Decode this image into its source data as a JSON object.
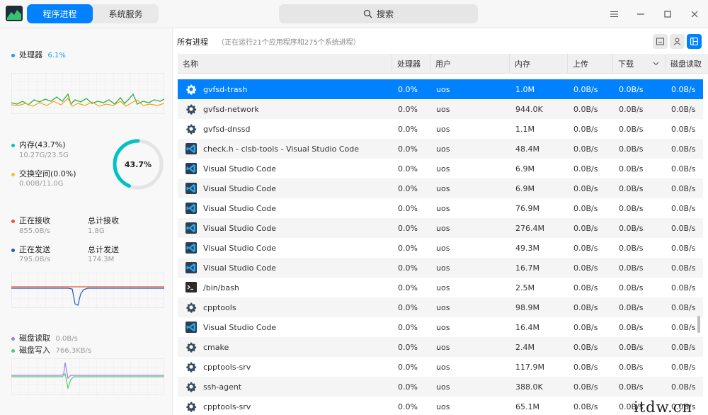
{
  "titlebar": {
    "tabs": [
      {
        "label": "程序进程",
        "active": true
      },
      {
        "label": "系统服务",
        "active": false
      }
    ],
    "search_label": "搜索"
  },
  "left": {
    "cpu": {
      "label": "处理器",
      "value": "6.1%",
      "color": "#1a9fe8"
    },
    "memory": {
      "label": "内存(43.7%)",
      "detail": "10.27G/23.5G",
      "color": "#00c3c3",
      "gauge_text": "43.7%",
      "gauge_fraction": 0.437
    },
    "swap": {
      "label": "交换空间(0.0%)",
      "detail": "0.00B/11.0G",
      "color": "#f1c232"
    },
    "network": {
      "recv_label": "正在接收",
      "recv_value": "855.0B/s",
      "recv_color": "#e8513a",
      "recv_total_label": "总计接收",
      "recv_total_value": "1.8G",
      "send_label": "正在发送",
      "send_value": "795.0B/s",
      "send_color": "#1d5bbf",
      "send_total_label": "总计发送",
      "send_total_value": "174.3M"
    },
    "disk": {
      "read_label": "磁盘读取",
      "read_value": "0.0B/s",
      "read_color": "#a07df0",
      "write_label": "磁盘写入",
      "write_value": "766.3KB/s",
      "write_color": "#4fd06a"
    }
  },
  "right": {
    "title": "所有进程",
    "subtitle": "（正在运行21个应用程序和275个系统进程）",
    "columns": {
      "name": "名称",
      "cpu": "处理器",
      "user": "用户",
      "memory": "内存",
      "upload": "上传",
      "download": "下载",
      "disk_read": "磁盘读取"
    },
    "rows": [
      {
        "name": "gvfsd-trash",
        "icon": "gear-icon",
        "cpu": "0.0%",
        "user": "uos",
        "mem": "1.0M",
        "up": "0.0B/s",
        "down": "0.0B/s",
        "disk": "0.0B/s",
        "selected": true
      },
      {
        "name": "gvfsd-network",
        "icon": "gear-icon",
        "cpu": "0.0%",
        "user": "uos",
        "mem": "944.0K",
        "up": "0.0B/s",
        "down": "0.0B/s",
        "disk": "0.0B/s"
      },
      {
        "name": "gvfsd-dnssd",
        "icon": "gear-icon",
        "cpu": "0.0%",
        "user": "uos",
        "mem": "1.1M",
        "up": "0.0B/s",
        "down": "0.0B/s",
        "disk": "0.0B/s"
      },
      {
        "name": "check.h - clsb-tools - Visual Studio Code",
        "icon": "vscode-icon",
        "cpu": "0.0%",
        "user": "uos",
        "mem": "48.4M",
        "up": "0.0B/s",
        "down": "0.0B/s",
        "disk": "0.0B/s"
      },
      {
        "name": "Visual Studio Code",
        "icon": "vscode-icon",
        "cpu": "0.0%",
        "user": "uos",
        "mem": "6.9M",
        "up": "0.0B/s",
        "down": "0.0B/s",
        "disk": "0.0B/s"
      },
      {
        "name": "Visual Studio Code",
        "icon": "vscode-icon",
        "cpu": "0.0%",
        "user": "uos",
        "mem": "6.9M",
        "up": "0.0B/s",
        "down": "0.0B/s",
        "disk": "0.0B/s"
      },
      {
        "name": "Visual Studio Code",
        "icon": "vscode-icon",
        "cpu": "0.0%",
        "user": "uos",
        "mem": "76.9M",
        "up": "0.0B/s",
        "down": "0.0B/s",
        "disk": "0.0B/s"
      },
      {
        "name": "Visual Studio Code",
        "icon": "vscode-icon",
        "cpu": "0.0%",
        "user": "uos",
        "mem": "276.4M",
        "up": "0.0B/s",
        "down": "0.0B/s",
        "disk": "0.0B/s"
      },
      {
        "name": "Visual Studio Code",
        "icon": "vscode-icon",
        "cpu": "0.0%",
        "user": "uos",
        "mem": "49.3M",
        "up": "0.0B/s",
        "down": "0.0B/s",
        "disk": "0.0B/s"
      },
      {
        "name": "Visual Studio Code",
        "icon": "vscode-icon",
        "cpu": "0.0%",
        "user": "uos",
        "mem": "16.7M",
        "up": "0.0B/s",
        "down": "0.0B/s",
        "disk": "0.0B/s"
      },
      {
        "name": "/bin/bash",
        "icon": "terminal-icon",
        "cpu": "0.0%",
        "user": "uos",
        "mem": "2.5M",
        "up": "0.0B/s",
        "down": "0.0B/s",
        "disk": "0.0B/s"
      },
      {
        "name": "cpptools",
        "icon": "gear-icon",
        "cpu": "0.0%",
        "user": "uos",
        "mem": "98.9M",
        "up": "0.0B/s",
        "down": "0.0B/s",
        "disk": "0.0B/s"
      },
      {
        "name": "Visual Studio Code",
        "icon": "vscode-icon",
        "cpu": "0.0%",
        "user": "uos",
        "mem": "16.4M",
        "up": "0.0B/s",
        "down": "0.0B/s",
        "disk": "0.0B/s"
      },
      {
        "name": "cmake",
        "icon": "gear-icon",
        "cpu": "0.0%",
        "user": "uos",
        "mem": "2.4M",
        "up": "0.0B/s",
        "down": "0.0B/s",
        "disk": "0.0B/s"
      },
      {
        "name": "cpptools-srv",
        "icon": "gear-icon",
        "cpu": "0.0%",
        "user": "uos",
        "mem": "117.9M",
        "up": "0.0B/s",
        "down": "0.0B/s",
        "disk": "0.0B/s"
      },
      {
        "name": "ssh-agent",
        "icon": "gear-icon",
        "cpu": "0.0%",
        "user": "uos",
        "mem": "388.0K",
        "up": "0.0B/s",
        "down": "0.0B/s",
        "disk": "0.0B/s"
      },
      {
        "name": "cpptools-srv",
        "icon": "gear-icon",
        "cpu": "0.0%",
        "user": "uos",
        "mem": "65.1M",
        "up": "0.0B/s",
        "down": "0.0B/s",
        "disk": "0.0B/s"
      }
    ]
  },
  "watermark": "itdw.cn",
  "accent_color": "#0081ff"
}
